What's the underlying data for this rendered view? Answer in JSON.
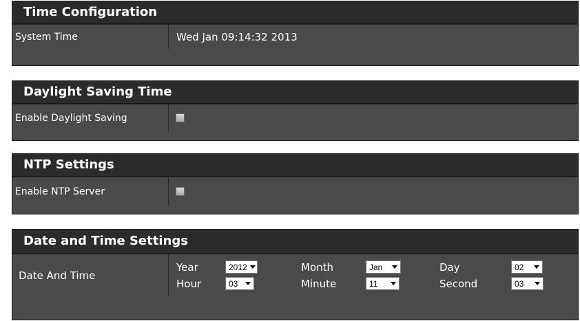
{
  "time_configuration": {
    "title": "Time Configuration",
    "system_time_label": "System Time",
    "system_time_value": "Wed Jan 09:14:32 2013"
  },
  "daylight_saving": {
    "title": "Daylight Saving Time",
    "enable_label": "Enable Daylight Saving",
    "enabled": false
  },
  "ntp": {
    "title": "NTP Settings",
    "enable_label": "Enable NTP Server",
    "enabled": false
  },
  "date_time": {
    "title": "Date and Time Settings",
    "label": "Date And Time",
    "year_label": "Year",
    "year_value": "2012",
    "month_label": "Month",
    "month_value": "Jan",
    "day_label": "Day",
    "day_value": "02",
    "hour_label": "Hour",
    "hour_value": "03",
    "minute_label": "Minute",
    "minute_value": "11",
    "second_label": "Second",
    "second_value": "03"
  },
  "colors": {
    "panel_bg": "#4a4a4a",
    "header_bg": "#2b2b2b",
    "text": "#ffffff"
  }
}
